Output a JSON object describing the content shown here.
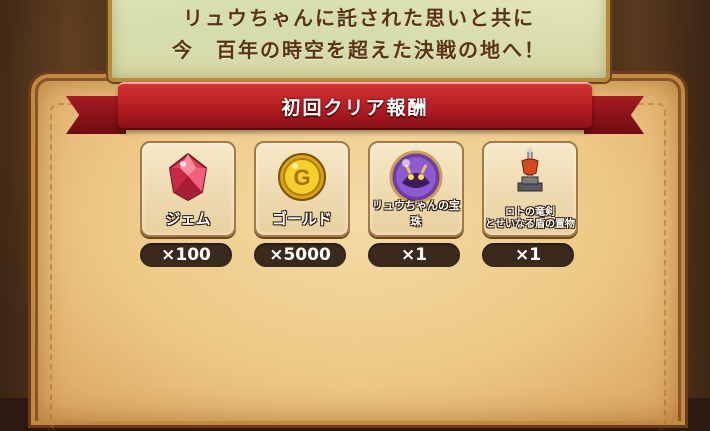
{
  "message": {
    "line1": "リュウちゃんに託された思いと共に",
    "line2": "今　百年の時空を超えた決戦の地へ！"
  },
  "banner": {
    "title": "初回クリア報酬"
  },
  "rewards": [
    {
      "name": "ジェム",
      "quantity": "×100",
      "icon": "gem-icon"
    },
    {
      "name": "ゴールド",
      "quantity": "×5000",
      "icon": "gold-coin-icon"
    },
    {
      "name": "リュウちゃんの宝珠",
      "quantity": "×1",
      "icon": "orb-icon"
    },
    {
      "name_line1": "ロトの竜剣",
      "name_line2": "とせいなる盾の置物",
      "quantity": "×1",
      "icon": "sword-shield-figurine-icon"
    }
  ],
  "colors": {
    "ribbon": "#b31d22",
    "parchment": "#edc985",
    "quantity_pill": "#3a2a1e"
  }
}
